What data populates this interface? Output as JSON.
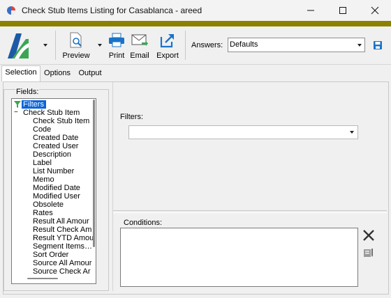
{
  "window": {
    "title": "Check Stub Items Listing for Casablanca - areed"
  },
  "toolbar": {
    "preview_label": "Preview",
    "print_label": "Print",
    "email_label": "Email",
    "export_label": "Export",
    "answers_label": "Answers:",
    "answers_value": "Defaults"
  },
  "tabs": [
    {
      "label": "Selection",
      "active": true
    },
    {
      "label": "Options",
      "active": false
    },
    {
      "label": "Output",
      "active": false
    }
  ],
  "fields": {
    "label": "Fields:",
    "tree": [
      {
        "label": "Filters",
        "level": 0,
        "selected": true
      },
      {
        "label": "Check Stub Item",
        "level": 0,
        "expander": "−"
      },
      {
        "label": "Check Stub Item",
        "level": 1
      },
      {
        "label": "Code",
        "level": 1
      },
      {
        "label": "Created Date",
        "level": 1
      },
      {
        "label": "Created User",
        "level": 1
      },
      {
        "label": "Description",
        "level": 1
      },
      {
        "label": "Label",
        "level": 1
      },
      {
        "label": "List Number",
        "level": 1
      },
      {
        "label": "Memo",
        "level": 1
      },
      {
        "label": "Modified Date",
        "level": 1
      },
      {
        "label": "Modified User",
        "level": 1
      },
      {
        "label": "Obsolete",
        "level": 1
      },
      {
        "label": "Rates",
        "level": 1
      },
      {
        "label": "Result All Amour",
        "level": 1
      },
      {
        "label": "Result Check Am",
        "level": 1
      },
      {
        "label": "Result YTD Amou",
        "level": 1
      },
      {
        "label": "Segment Items…",
        "level": 1
      },
      {
        "label": "Sort Order",
        "level": 1
      },
      {
        "label": "Source All Amour",
        "level": 1
      },
      {
        "label": "Source Check Ar",
        "level": 1
      }
    ]
  },
  "filters": {
    "label": "Filters:",
    "value": ""
  },
  "conditions": {
    "label": "Conditions:"
  },
  "colors": {
    "accent_strip": "#8b8000",
    "tree_selection": "#0a64d8",
    "icon_blue": "#1a73c8",
    "logo_green": "#3aa655",
    "logo_blue": "#1d5aa6"
  }
}
